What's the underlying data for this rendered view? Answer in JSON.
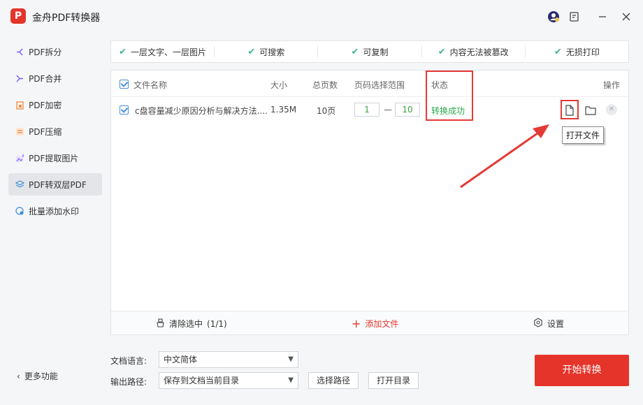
{
  "app": {
    "title": "金舟PDF转换器",
    "logo_text": "P"
  },
  "sidebar": {
    "items": [
      {
        "label": "PDF拆分",
        "icon": "split-icon"
      },
      {
        "label": "PDF合并",
        "icon": "merge-icon"
      },
      {
        "label": "PDF加密",
        "icon": "lock-icon"
      },
      {
        "label": "PDF压缩",
        "icon": "compress-icon"
      },
      {
        "label": "PDF提取图片",
        "icon": "image-icon"
      },
      {
        "label": "PDF转双层PDF",
        "icon": "layers-icon",
        "active": true
      },
      {
        "label": "批量添加水印",
        "icon": "watermark-icon"
      }
    ],
    "more": "更多功能"
  },
  "features": [
    "一层文字、一层图片",
    "可搜索",
    "可复制",
    "内容无法被篡改",
    "无损打印"
  ],
  "table": {
    "headers": {
      "name": "文件名称",
      "size": "大小",
      "pages": "总页数",
      "range": "页码选择范围",
      "status": "状态",
      "ops": "操作"
    },
    "rows": [
      {
        "name": "c盘容量减少原因分析与解决方法....",
        "size": "1.35M",
        "pages": "10页",
        "from": "1",
        "dash": "—",
        "to": "10",
        "status": "转换成功"
      }
    ],
    "tooltip": "打开文件"
  },
  "footer": {
    "clear": "清除选中",
    "clear_count": "(1/1)",
    "add": "添加文件",
    "settings": "设置"
  },
  "options": {
    "lang_label": "文档语言:",
    "lang_value": "中文简体",
    "path_label": "输出路径:",
    "path_value": "保存到文档当前目录",
    "choose_path": "选择路径",
    "open_dir": "打开目录",
    "start": "开始转换"
  },
  "colors": {
    "accent": "#e5342a",
    "success": "#2ca84c",
    "check": "#3db88b"
  }
}
